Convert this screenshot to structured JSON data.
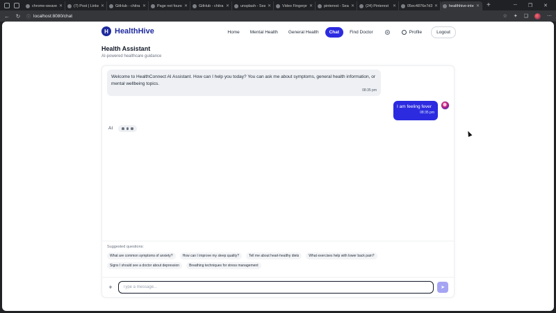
{
  "browser": {
    "tabs": [
      {
        "title": "chrome-weave",
        "active": false
      },
      {
        "title": "(7) Post | LinkedIn",
        "active": false
      },
      {
        "title": "GitHub - chitra",
        "active": false
      },
      {
        "title": "Page not found",
        "active": false
      },
      {
        "title": "GitHub - chitra",
        "active": false
      },
      {
        "title": "unsplash - Sear",
        "active": false
      },
      {
        "title": "Video Fingerpri",
        "active": false
      },
      {
        "title": "pinterest - Sear",
        "active": false
      },
      {
        "title": "(24) Pinterest",
        "active": false
      },
      {
        "title": "05ec4876e7d3",
        "active": false
      },
      {
        "title": "healthhive-inte",
        "active": true
      }
    ],
    "url": "localhost:8080/chat"
  },
  "nav": {
    "brand": "HealthHive",
    "brand_letter": "H",
    "items": [
      "Home",
      "Mental Health",
      "General Health",
      "Chat",
      "Find Doctor"
    ],
    "active_item": "Chat",
    "profile": "Profile",
    "logout": "Logout"
  },
  "page": {
    "title": "Health Assistant",
    "subtitle": "AI-powered healthcare guidance"
  },
  "chat": {
    "messages": [
      {
        "sender": "ai",
        "text": "Welcome to HealthConnect AI Assistant. How can I help you today? You can ask me about symptoms, general health information, or mental wellbeing topics.",
        "time": "08:35 pm"
      },
      {
        "sender": "user",
        "text": "I am feeling fever",
        "time": "08:35 pm"
      }
    ],
    "typing_label": "AI"
  },
  "suggestions": {
    "label": "Suggested questions:",
    "items": [
      "What are common symptoms of anxiety?",
      "How can I improve my sleep quality?",
      "Tell me about heart-healthy diets",
      "What exercises help with lower back pain?",
      "Signs I should see a doctor about depression",
      "Breathing techniques for stress management"
    ]
  },
  "composer": {
    "placeholder": "Type a message..."
  },
  "colors": {
    "brand": "#1e2a9e",
    "accent": "#2c2be0",
    "send_disabled": "#a5a4f3"
  }
}
